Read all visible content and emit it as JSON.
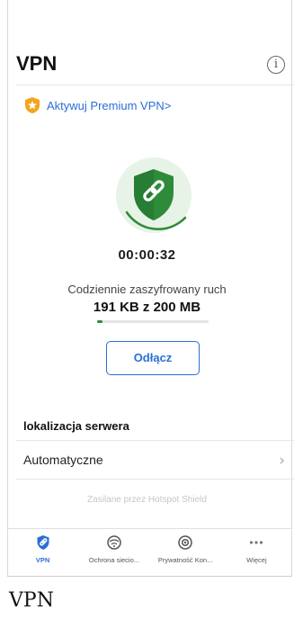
{
  "header": {
    "title": "VPN",
    "info_icon": "info-icon"
  },
  "premium": {
    "label": "Aktywuj Premium VPN>",
    "icon": "premium-shield-star-icon",
    "color": "#2b6fd6"
  },
  "vpn": {
    "status_icon": "shield-link-icon",
    "timer": "00:00:32",
    "traffic_label": "Codziennie zaszyfrowany ruch",
    "traffic_value": "191 KB z 200 MB",
    "traffic_progress": 0.05,
    "disconnect_label": "Odłącz",
    "accent": "#2e8b3a"
  },
  "server": {
    "section_title": "lokalizacja serwera",
    "location": "Automatyczne",
    "chevron_icon": "chevron-right-icon"
  },
  "powered_by": "Zasilane przez Hotspot Shield",
  "tabs": [
    {
      "label": "VPN",
      "icon": "vpn-shield-icon",
      "active": true
    },
    {
      "label": "Ochrona siecio...",
      "icon": "network-protection-icon",
      "active": false
    },
    {
      "label": "Prywatność Kon...",
      "icon": "privacy-icon",
      "active": false
    },
    {
      "label": "Więcej",
      "icon": "more-icon",
      "active": false
    }
  ],
  "caption": "VPN"
}
